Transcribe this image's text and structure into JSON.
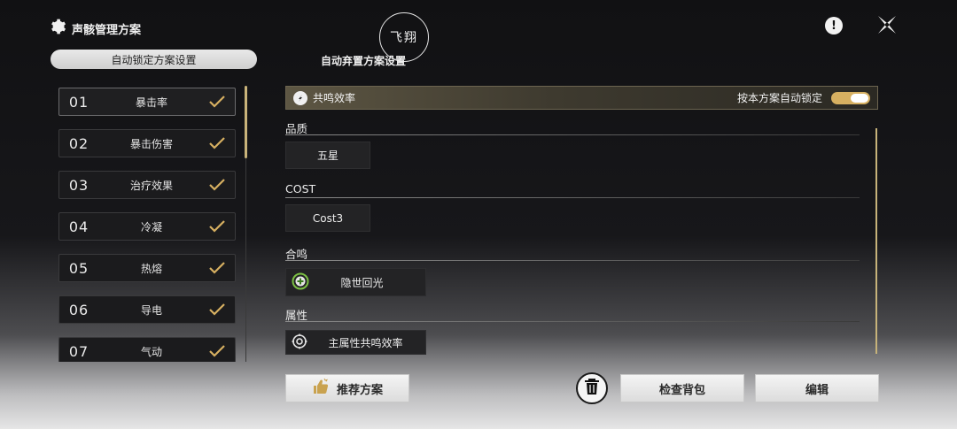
{
  "header": {
    "title": "声骸管理方案",
    "watermark": "飞翔",
    "info_symbol": "!"
  },
  "tabs": [
    {
      "label": "自动锁定方案设置",
      "active": true
    },
    {
      "label": "自动弃置方案设置",
      "active": false
    }
  ],
  "schemes": [
    {
      "num": "01",
      "label": "暴击率",
      "checked": true
    },
    {
      "num": "02",
      "label": "暴击伤害",
      "checked": true
    },
    {
      "num": "03",
      "label": "治疗效果",
      "checked": true
    },
    {
      "num": "04",
      "label": "冷凝",
      "checked": true
    },
    {
      "num": "05",
      "label": "热熔",
      "checked": true
    },
    {
      "num": "06",
      "label": "导电",
      "checked": true
    },
    {
      "num": "07",
      "label": "气动",
      "checked": true
    }
  ],
  "detail": {
    "scheme_title": "共鸣效率",
    "auto_lock_label": "按本方案自动锁定",
    "auto_lock_on": true,
    "quality": {
      "label": "品质",
      "value": "五星"
    },
    "cost": {
      "label": "COST",
      "value": "Cost3"
    },
    "sonata": {
      "label": "合鸣",
      "value": "隐世回光"
    },
    "attribute": {
      "label": "属性",
      "value": "主属性共鸣效率"
    }
  },
  "actions": {
    "recommend": "推荐方案",
    "check_bag": "检查背包",
    "edit": "编辑"
  },
  "colors": {
    "accent_gold": "#d7b061",
    "sonata_green": "#7bc043"
  }
}
